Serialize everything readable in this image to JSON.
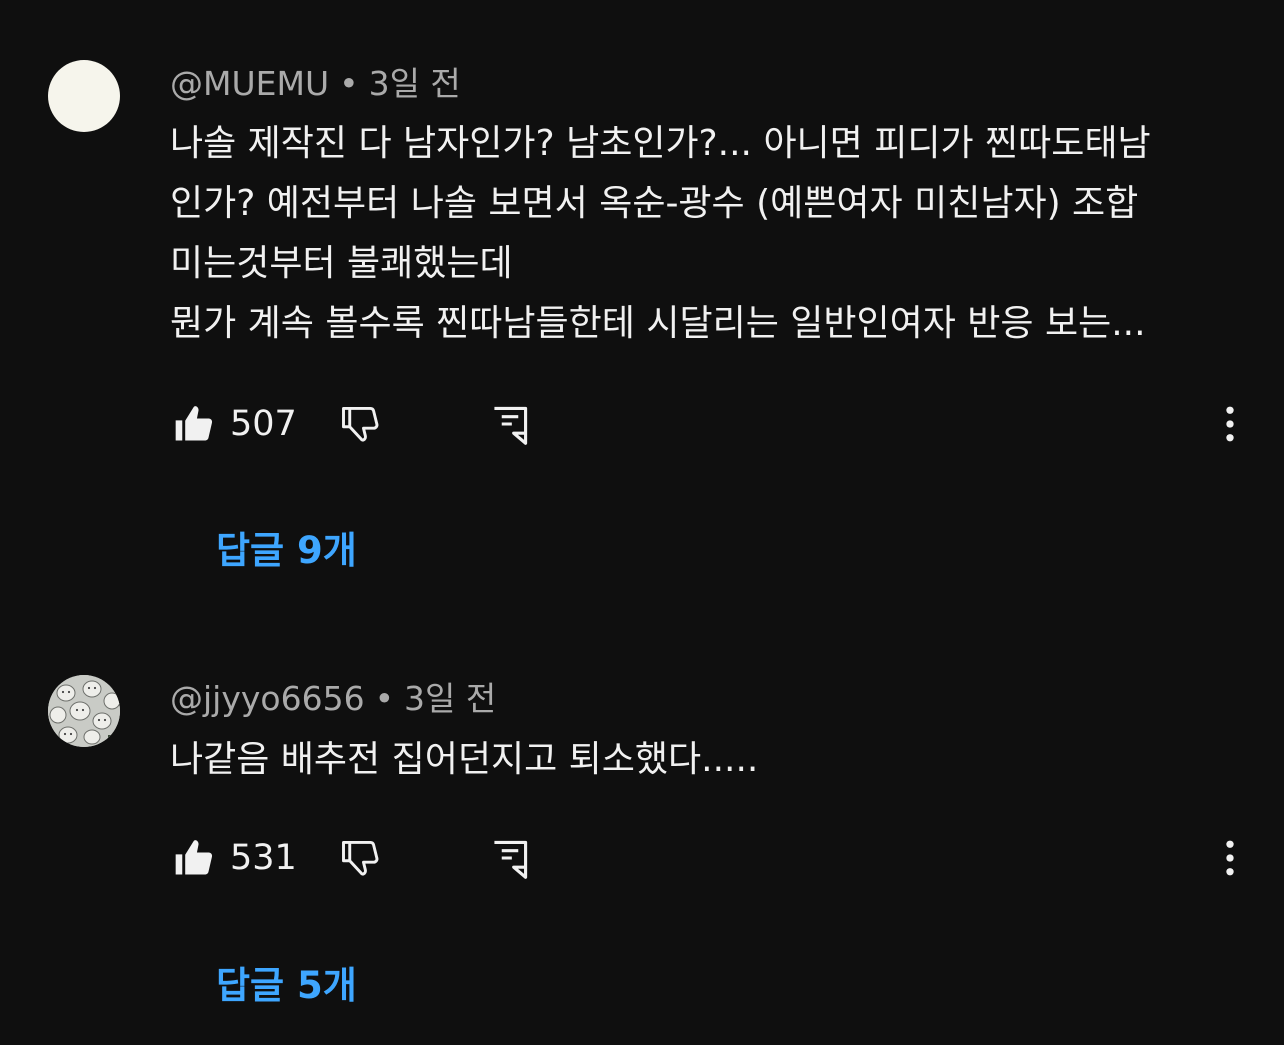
{
  "comments": [
    {
      "author": "@MUEMU",
      "time": "3일 전",
      "lines": [
        "나솔 제작진 다 남자인가? 남초인가?... 아니면 피디가 찐따도태남",
        "인가? 예전부터 나솔 보면서 옥순-광수 (예쁜여자 미친남자) 조합",
        "미는것부터 불쾌했는데",
        "뭔가 계속 볼수록 찐따남들한테 시달리는 일반인여자 반응 보는..."
      ],
      "likes": "507",
      "replies": "답글 9개"
    },
    {
      "author": "@jjyyo6656",
      "time": "3일 전",
      "lines": [
        "나같음 배추전 집어던지고 퇴소했다....."
      ],
      "likes": "531",
      "replies": "답글 5개"
    }
  ],
  "separator": "•",
  "icons": {
    "like": "thumbs-up-icon",
    "dislike": "thumbs-down-icon",
    "reply": "comment-icon",
    "more": "more-vert-icon"
  },
  "colors": {
    "background": "#0f0f0f",
    "text": "#f1f1f1",
    "meta": "#aaaaaa",
    "link": "#3ea6ff"
  }
}
